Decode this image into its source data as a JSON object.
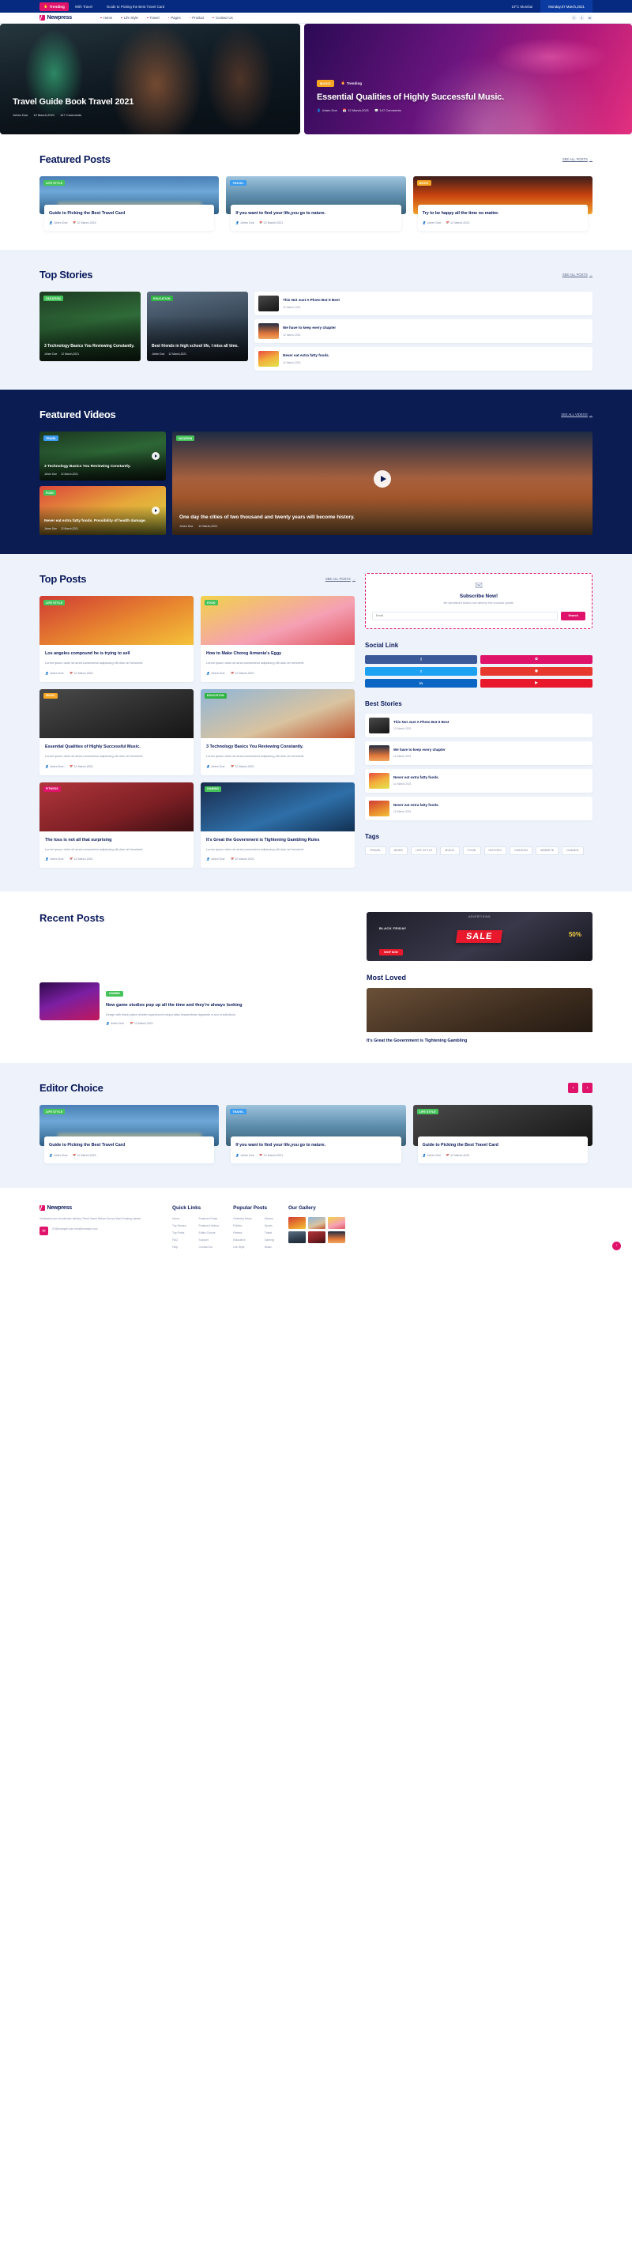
{
  "topbar": {
    "trending_label": "Trending",
    "items": [
      "With Travel",
      "Guide to Picking the Best Travel Card"
    ],
    "weather": "19°C Mumbai",
    "date": "Monday,07 March,2021"
  },
  "nav": {
    "brand": "Newpress",
    "links": [
      "Home",
      "Life Style",
      "Travel",
      "Pages",
      "Product",
      "Contact Us"
    ],
    "social": [
      "f",
      "t",
      "in"
    ]
  },
  "hero": {
    "left": {
      "title": "Travel Guide Book Travel 2021",
      "meta": [
        "Johen Doe",
        "12 March,2021",
        "147 Comments"
      ]
    },
    "right": {
      "badge": "MUSIC",
      "trending": "Trending",
      "title": "Essential Qualities of Highly Successful Music.",
      "meta": [
        "Johen Doe",
        "12 March,2021",
        "147 Comments"
      ]
    }
  },
  "featured_posts": {
    "title": "Featured Posts",
    "see_all": "SEE ALL POSTS",
    "cards": [
      {
        "label": "LIFE STYLE",
        "title": "Guide to Picking the Best Travel Card",
        "author": "Johen Doe",
        "date": "12 March,2021"
      },
      {
        "label": "TRAVEL",
        "title": "If you want to find your life,you go to nature.",
        "author": "Johen Doe",
        "date": "12 March,2021"
      },
      {
        "label": "MUSIC",
        "title": "Try to be happy all the time no matter.",
        "author": "Johen Doe",
        "date": "12 March,2021"
      }
    ]
  },
  "top_stories": {
    "title": "Top Stories",
    "see_all": "SEE ALL POSTS",
    "big": [
      {
        "label": "VACATION",
        "title": "3 Technology Basics You Reviewing Constantly.",
        "author": "Johen Doe",
        "date": "12 March,2021"
      },
      {
        "label": "EDUCATION",
        "title": "Best friends in high school life, I miss all time.",
        "author": "Johen Doe",
        "date": "12 March,2021"
      }
    ],
    "list": [
      {
        "title": "This Not Just A Photo But It Best",
        "date": "12 March,2021"
      },
      {
        "title": "We have to keep every chapter",
        "date": "12 March,2021"
      },
      {
        "title": "Never eat extra fatty foods.",
        "date": "12 March,2021"
      }
    ]
  },
  "featured_videos": {
    "title": "Featured Videos",
    "see_all": "SEE ALL VIDEOS",
    "small": [
      {
        "label": "TRAVEL",
        "title": "3 Technology Basics You Reviewing Constantly.",
        "author": "Johen Doe",
        "date": "12 March,2021"
      },
      {
        "label": "FOOD",
        "title": "Never eat extra fatty foods. Possibility of health damage.",
        "author": "Johen Doe",
        "date": "12 March,2021"
      }
    ],
    "large": {
      "label": "VACATION",
      "title": "One day the cities of two thousand and twenty years will become history.",
      "author": "Johen Doe",
      "date": "12 March,2021"
    }
  },
  "top_posts": {
    "title": "Top Posts",
    "see_all": "SEE ALL POSTS",
    "cards": [
      {
        "label": "LIFE STYLE",
        "title": "Los angeles compound he is trying to sell",
        "desc": "Lorem ipsum dolor sit amet,consectetur adipiscing elit duis vel hendrerit.",
        "author": "Johen Doe",
        "date": "12 March,2021"
      },
      {
        "label": "FOOD",
        "title": "How to Make Choreg Armenia's Eggy",
        "desc": "Lorem ipsum dolor sit amet,consectetur adipiscing elit duis vel hendrerit.",
        "author": "Johen Doe",
        "date": "12 March,2021"
      },
      {
        "label": "MUSIC",
        "title": "Essential Qualities of Highly Successful Music.",
        "desc": "Lorem ipsum dolor sit amet,consectetur adipiscing elit duis vel hendrerit.",
        "author": "Johen Doe",
        "date": "12 March,2021"
      },
      {
        "label": "EDUCATION",
        "title": "3 Technology Basics You Reviewing Constantly.",
        "desc": "Lorem ipsum dolor sit amet,consectetur adipiscing elit duis vel hendrerit.",
        "author": "Johen Doe",
        "date": "12 March,2021"
      },
      {
        "label": "FITNESS",
        "title": "The loss is not all that surprising",
        "desc": "Lorem ipsum dolor sit amet,consectetur adipiscing elit duis vel hendrerit.",
        "author": "Johen Doe",
        "date": "12 March,2021"
      },
      {
        "label": "GAMING",
        "title": "It's Great the Government is Tightening Gambling Rules",
        "desc": "Lorem ipsum dolor sit amet,consectetur adipiscing elit duis vel hendrerit.",
        "author": "Johen Doe",
        "date": "12 March,2021"
      }
    ]
  },
  "sidebar": {
    "subscribe": {
      "title": "Subscribe Now!",
      "sub": "We specialized studios and delivery free products update.",
      "placeholder": "Email",
      "button": "Search"
    },
    "social_title": "Social Link",
    "social_tiles": [
      {
        "icon": "f",
        "color": "#3b5998"
      },
      {
        "icon": "✿",
        "color": "#e0136a"
      },
      {
        "icon": "t",
        "color": "#1da1f2"
      },
      {
        "icon": "◉",
        "color": "#e8392f"
      },
      {
        "icon": "in",
        "color": "#0a66c2"
      },
      {
        "icon": "▶",
        "color": "#e8192c"
      }
    ],
    "best_stories_title": "Best Stories",
    "best_stories": [
      {
        "title": "This Not Just A Photo But It Best",
        "date": "12 March,2021"
      },
      {
        "title": "We have to keep every chapter",
        "date": "12 March,2021"
      },
      {
        "title": "Never eat extra fatty foods.",
        "date": "12 March,2021"
      },
      {
        "title": "Never eat extra fatty foods.",
        "date": "12 March,2021"
      }
    ],
    "tags_title": "Tags",
    "tags": [
      "TRAVEL",
      "NEWS",
      "LIFE STYLE",
      "MUSIC",
      "FOOD",
      "HISTORY",
      "FASHION",
      "WEBSITE",
      "GAMING"
    ]
  },
  "recent_posts": {
    "title": "Recent Posts",
    "item": {
      "label": "GAMING",
      "title": "New game studios pop up all the time and they're always looking",
      "desc": "Design with black justice droblen apsurecent volupa tatas heapenibean digrasete si seu si sollicitudo.",
      "author": "Johen Doe",
      "date": "12 March,2021"
    },
    "ad": {
      "label": "ADVERTISING",
      "headline": "BLACK FRIDAY",
      "sale": "SALE",
      "discount": "50%",
      "button": "SHOP NOW"
    },
    "most_loved_title": "Most Loved",
    "most_loved": {
      "title": "It's Great the Government is Tightening Gambling"
    }
  },
  "editor_choice": {
    "title": "Editor Choice",
    "cards": [
      {
        "label": "LIFE STYLE",
        "title": "Guide to Picking the Best Travel Card",
        "author": "Johen Doe",
        "date": "12 March,2021"
      },
      {
        "label": "TRAVEL",
        "title": "If you want to find your life,you go to nature.",
        "author": "Johen Doe",
        "date": "12 March,2021"
      },
      {
        "label": "LIFE STYLE",
        "title": "Guide to Picking the Best Travel Card",
        "author": "Johen Doe",
        "date": "12 March,2021"
      }
    ]
  },
  "footer": {
    "brand": "Newpress",
    "desc": "Verification are should take delivery Trend Game Before Survey Work Dealing market.",
    "contact": "07@example.com info@example.com",
    "quick_links_title": "Quick Links",
    "quick_links_a": [
      "Home",
      "Top Stories",
      "Top Posts",
      "FAQ",
      "Help"
    ],
    "quick_links_b": [
      "Featured Posts",
      "Featured Videos",
      "Editor Choice",
      "Support",
      "Contact Us"
    ],
    "popular_title": "Popular Posts",
    "popular_a": [
      "Celebrity News",
      "Politics",
      "Fitness",
      "Education",
      "Life Style"
    ],
    "popular_b": [
      "Movies",
      "Sports",
      "Travel",
      "Gaming",
      "Music"
    ],
    "gallery_title": "Our Gallery"
  },
  "colors": {
    "navy": "#062a7f",
    "pink": "#e0136a",
    "dark": "#0a1c52",
    "light": "#eef3fb"
  }
}
